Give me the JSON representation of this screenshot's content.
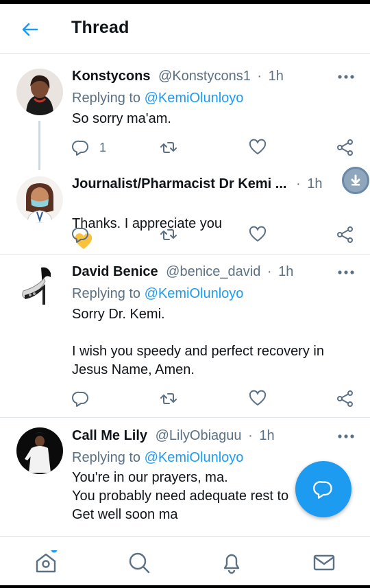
{
  "header": {
    "title": "Thread",
    "back_icon": "arrow-left-icon",
    "accent": "#1d9bf0"
  },
  "tweets": [
    {
      "name": "Konstycons",
      "handle": "@Konstycons1",
      "dot": "·",
      "time": "1h",
      "replying_prefix": "Replying to",
      "replying_to": "@KemiOlunloyo",
      "text": "So sorry ma'am.",
      "reply_count": "1"
    },
    {
      "name": "Journalist/Pharmacist Dr Kemi ...",
      "dot": "·",
      "time": "1h",
      "text": "Thanks. I appreciate you",
      "emoji": "yellow-heart-icon"
    },
    {
      "name": "David Benice",
      "handle": "@benice_david",
      "dot": "·",
      "time": "1h",
      "replying_prefix": "Replying to",
      "replying_to": "@KemiOlunloyo",
      "text": "Sorry Dr. Kemi.\n\nI wish you speedy and perfect recovery in\nJesus Name, Amen."
    },
    {
      "name": "Call Me Lily",
      "handle": "@LilyObiaguu",
      "dot": "·",
      "time": "1h",
      "replying_prefix": "Replying to",
      "replying_to": "@KemiOlunloyo",
      "text": "You're in our prayers, ma.\nYou probably need adequate rest to\nGet well soon ma"
    }
  ],
  "fab": {
    "icon": "compose-reply-icon"
  },
  "nav": {
    "items": [
      "home-icon",
      "search-icon",
      "notifications-icon",
      "messages-icon"
    ],
    "home_notification_dot": true
  }
}
